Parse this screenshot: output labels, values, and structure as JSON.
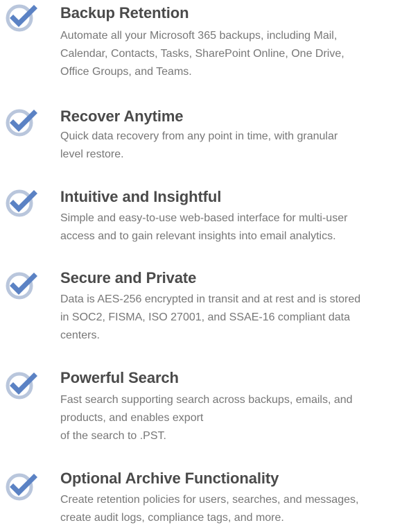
{
  "colors": {
    "check_fill": "#5b82c4",
    "check_ring": "#b9c6dc",
    "title": "#4a4a4a",
    "text": "#777777"
  },
  "icon": "checkmark-badge-icon",
  "features": [
    {
      "title": "Backup Retention",
      "description": "Automate all your Microsoft 365 backups, including Mail,\nCalendar, Contacts, Tasks, SharePoint Online, One Drive,\nOffice Groups, and Teams."
    },
    {
      "title": "Recover Anytime",
      "description": "Quick data recovery from any point in time, with granular\nlevel restore."
    },
    {
      "title": "Intuitive and Insightful",
      "description": "Simple and easy-to-use web-based interface for multi-user\naccess and to gain relevant insights into email analytics."
    },
    {
      "title": "Secure and Private",
      "description": "Data is AES-256 encrypted in transit and at rest and is stored\nin SOC2, FISMA, ISO 27001, and SSAE-16 compliant data\ncenters."
    },
    {
      "title": "Powerful Search",
      "description": "Fast search supporting search across backups, emails, and\nproducts, and enables export\nof the search to .PST."
    },
    {
      "title": "Optional Archive Functionality",
      "description": "Create retention policies for users, searches, and messages,\ncreate audit logs, compliance tags, and more."
    }
  ]
}
